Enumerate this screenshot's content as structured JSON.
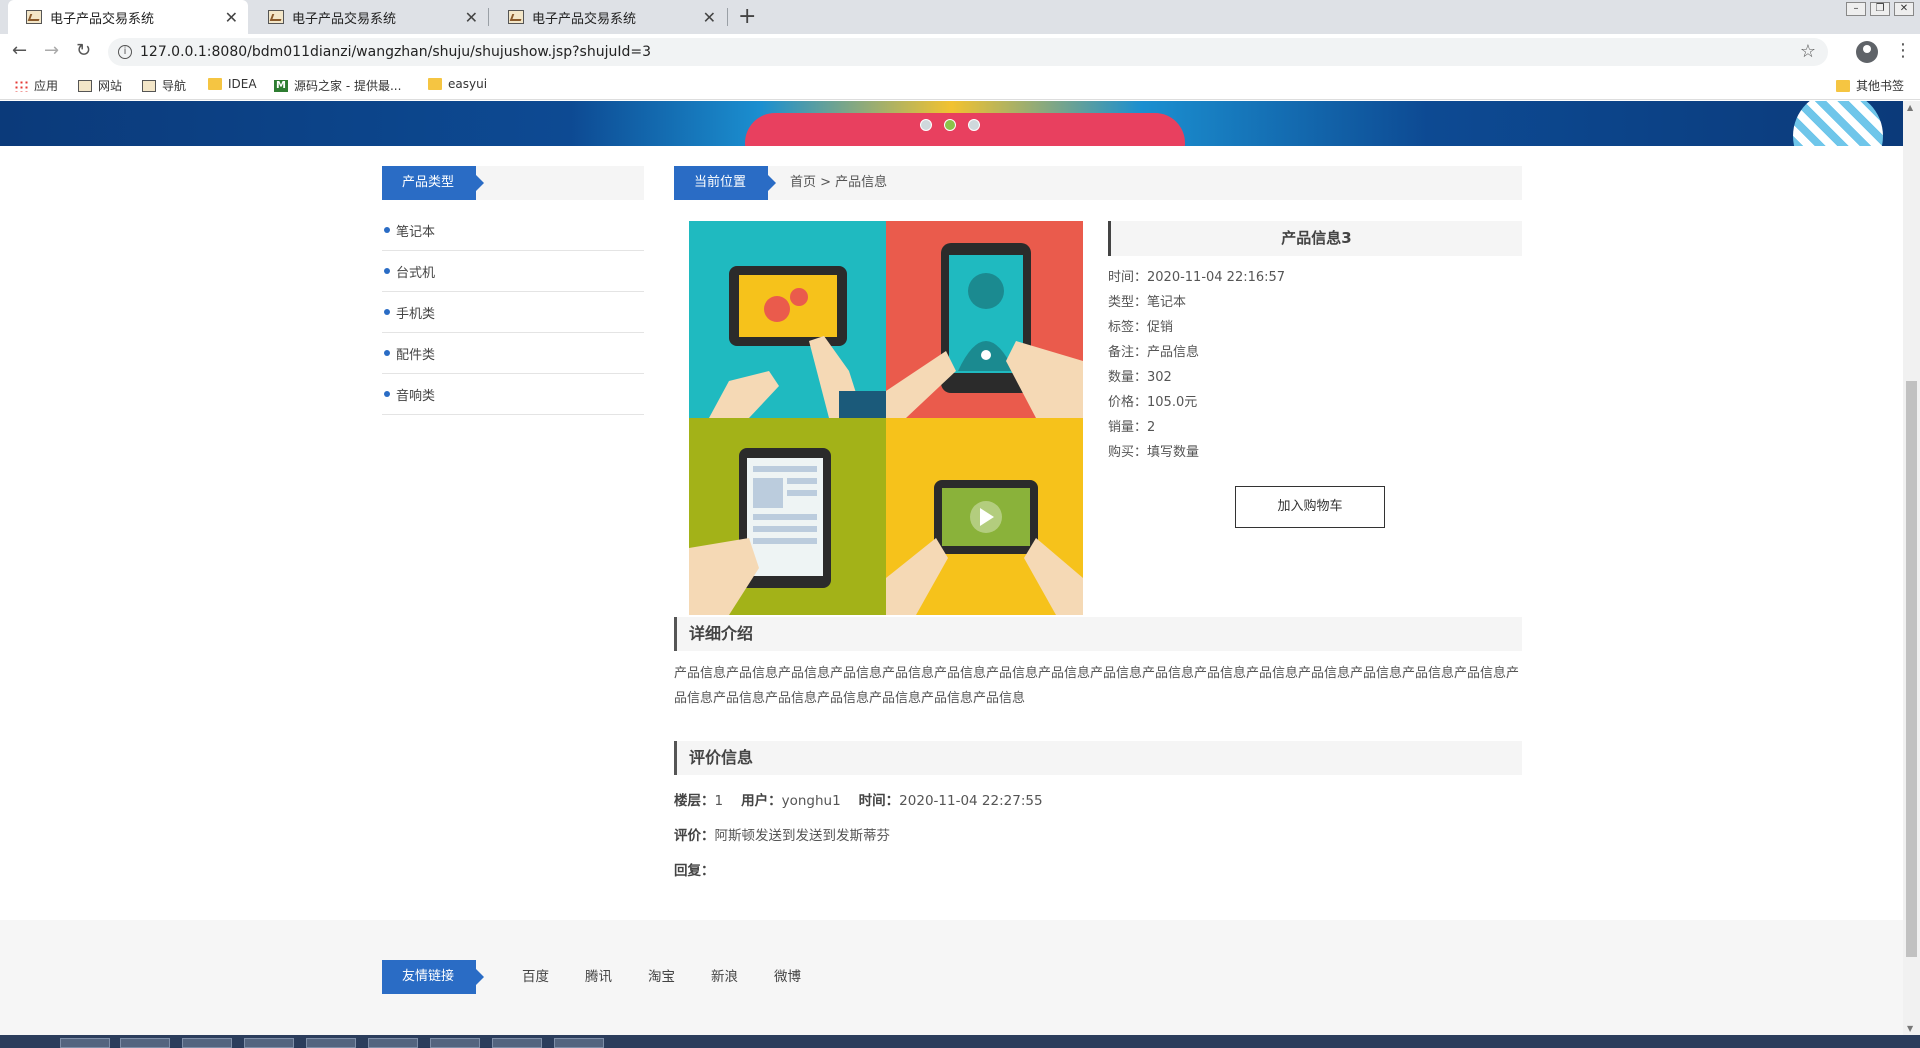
{
  "browser": {
    "tabs": [
      {
        "title": "电子产品交易系统",
        "active": true
      },
      {
        "title": "电子产品交易系统",
        "active": false
      },
      {
        "title": "电子产品交易系统",
        "active": false
      }
    ],
    "url": "127.0.0.1:8080/bdm011dianzi/wangzhan/shuju/shujushow.jsp?shujuId=3",
    "bookmarks": {
      "apps": "应用",
      "b1": "网站",
      "b2": "导航",
      "b3": "IDEA",
      "b4": "源码之家 - 提供最...",
      "b5": "easyui",
      "other": "其他书签"
    }
  },
  "sidebar": {
    "title": "产品类型",
    "items": [
      "笔记本",
      "台式机",
      "手机类",
      "配件类",
      "音响类"
    ]
  },
  "breadcrumb": {
    "label": "当前位置",
    "path": "首页 > 产品信息"
  },
  "product": {
    "title": "产品信息3",
    "rows": [
      "时间：2020-11-04 22:16:57",
      "类型：笔记本",
      "标签：促销",
      "备注：产品信息",
      "数量：302",
      "价格：105.0元",
      "销量：2",
      "购买：填写数量"
    ],
    "cart_button": "加入购物车"
  },
  "detail": {
    "heading": "详细介绍",
    "text": "产品信息产品信息产品信息产品信息产品信息产品信息产品信息产品信息产品信息产品信息产品信息产品信息产品信息产品信息产品信息产品信息产品信息产品信息产品信息产品信息产品信息产品信息产品信息"
  },
  "review": {
    "heading": "评价信息",
    "floor_label": "楼层：",
    "floor": "1",
    "user_label": "用户：",
    "user": "yonghu1",
    "time_label": "时间：",
    "time": "2020-11-04 22:27:55",
    "comment_label": "评价：",
    "comment": "阿斯顿发送到发送到发斯蒂芬",
    "reply_label": "回复：",
    "reply": ""
  },
  "footer": {
    "title": "友情链接",
    "links": [
      "百度",
      "腾讯",
      "淘宝",
      "新浪",
      "微博"
    ]
  },
  "colors": {
    "accent": "#2a6cc5"
  }
}
